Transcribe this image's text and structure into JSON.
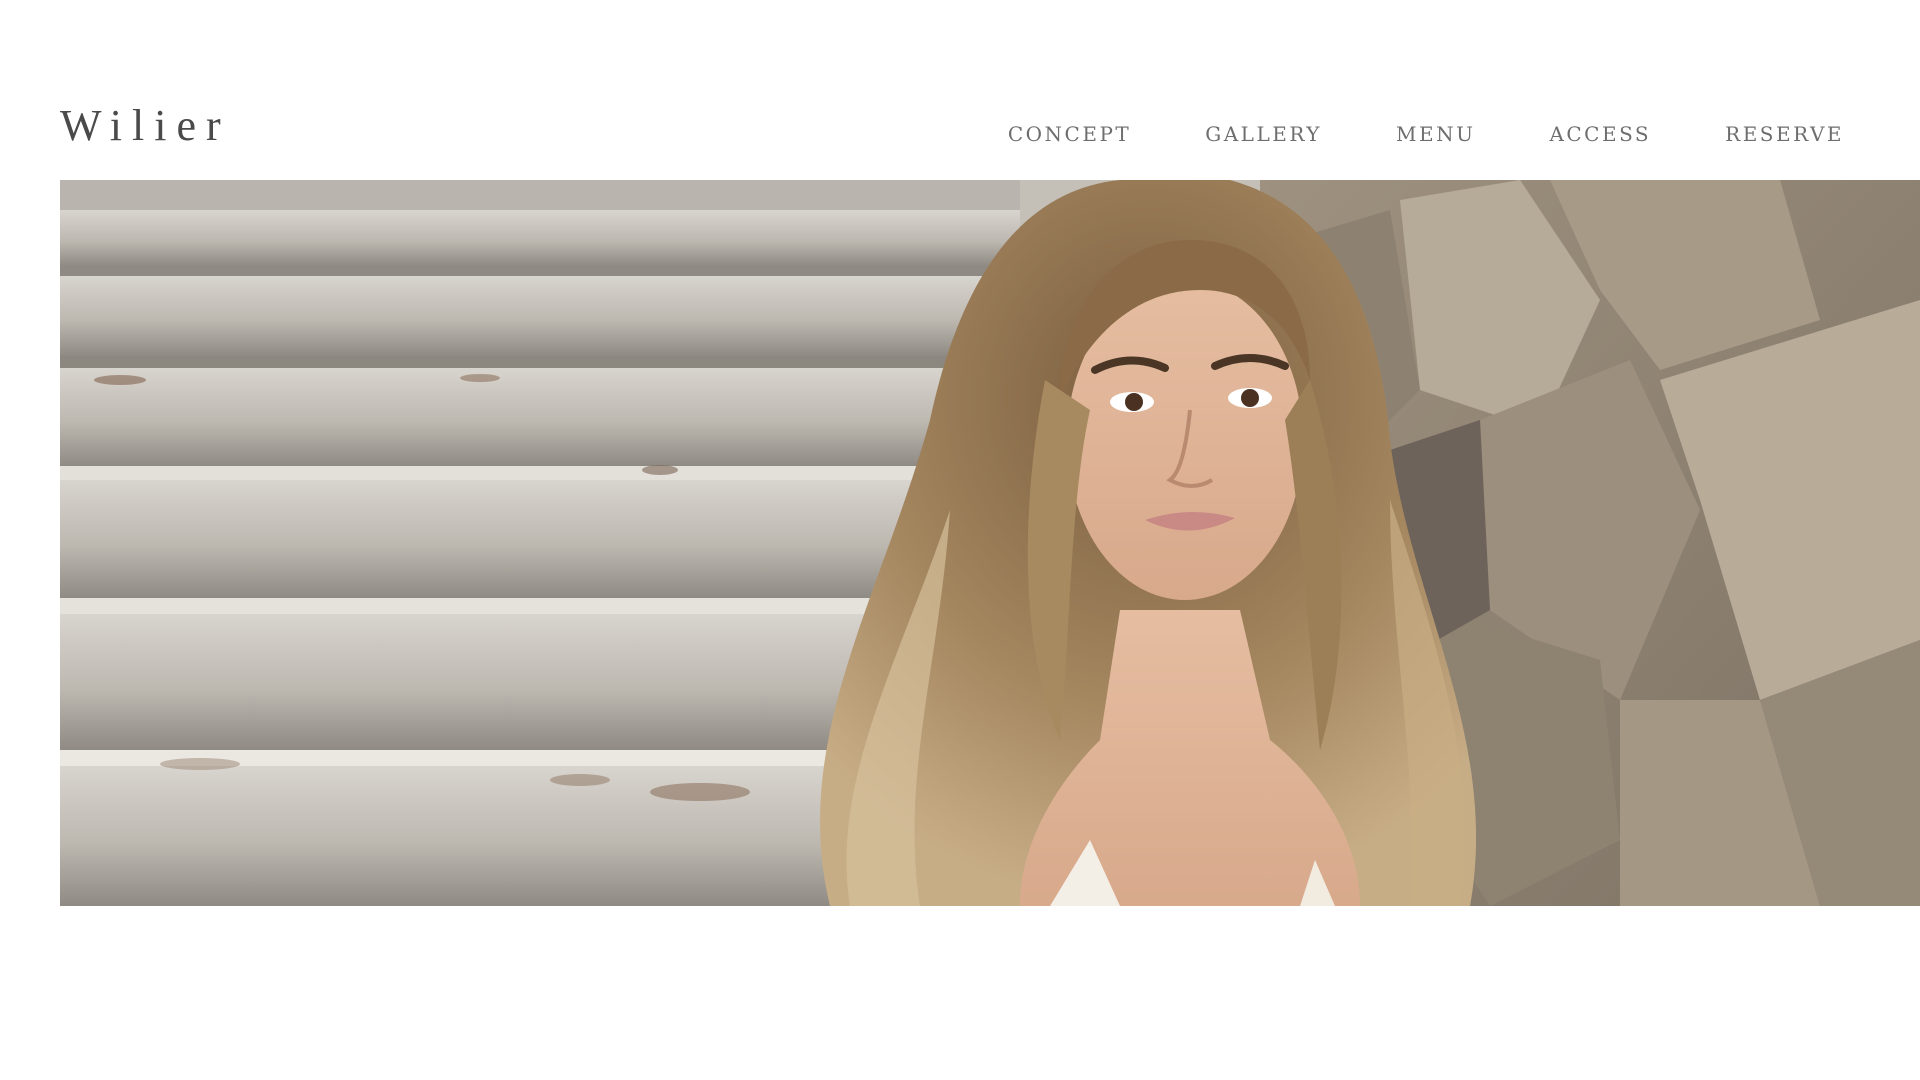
{
  "header": {
    "logo": "Wilier",
    "nav": [
      {
        "label": "CONCEPT"
      },
      {
        "label": "GALLERY"
      },
      {
        "label": "MENU"
      },
      {
        "label": "ACCESS"
      },
      {
        "label": "RESERVE"
      }
    ]
  },
  "hero": {
    "image": "photo-of-woman-with-long-hair-by-stone-wall-and-steps",
    "colors": {
      "steps_light": "#cfcac3",
      "steps_dark": "#9c978f",
      "wall_light": "#b8ab98",
      "wall_dark": "#6f655a",
      "hair": "#9a7a55",
      "hair_light": "#c9ad82",
      "skin": "#e0b59a"
    }
  }
}
